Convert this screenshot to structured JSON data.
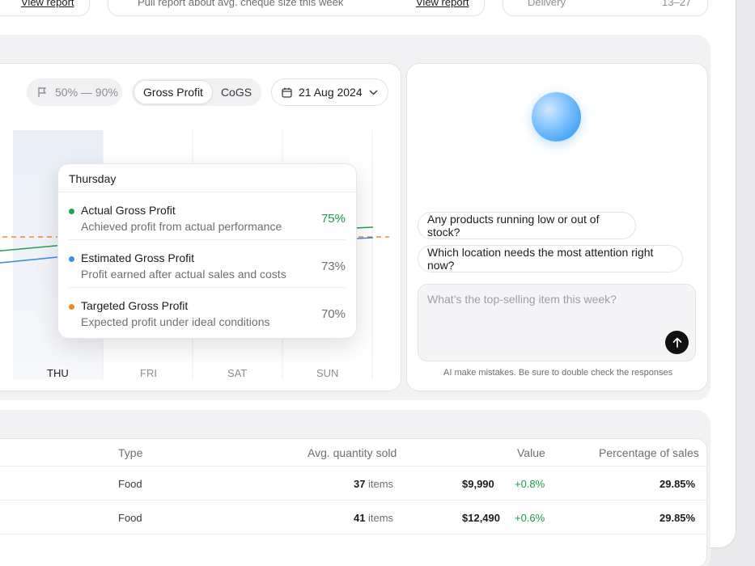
{
  "top_strip": {
    "left_link": "View report",
    "middle_text": "Pull report about avg. cheque size this week",
    "middle_link": "View report",
    "right_label": "Delivery",
    "right_value": "13–27"
  },
  "chart_controls": {
    "threshold_range": "50% — 90%",
    "segments": [
      {
        "label": "Gross Profit",
        "active": true
      },
      {
        "label": "CoGS",
        "active": false
      }
    ],
    "date": "21 Aug 2024"
  },
  "chart_data": {
    "type": "line",
    "categories": [
      "THU",
      "FRI",
      "SAT",
      "SUN"
    ],
    "series": [
      {
        "name": "Actual Gross Profit",
        "color": "#1ea356"
      },
      {
        "name": "Estimated Gross Profit",
        "color": "#3d8fe0"
      },
      {
        "name": "Targeted Gross Profit",
        "color": "#ef8a2c"
      }
    ],
    "highlighted_category": "THU"
  },
  "tooltip": {
    "title": "Thursday",
    "rows": [
      {
        "title": "Actual Gross Profit",
        "subtitle": "Achieved profit from actual performance",
        "value": "75%",
        "color": "#1ea356"
      },
      {
        "title": "Estimated Gross Profit",
        "subtitle": "Profit earned after actual sales and costs",
        "value": "73%",
        "color": "#3d8fe0"
      },
      {
        "title": "Targeted Gross Profit",
        "subtitle": "Expected profit under ideal conditions",
        "value": "70%",
        "color": "#ef8a2c"
      }
    ]
  },
  "assistant": {
    "suggestions": [
      "Any products running low or out of stock?",
      "Which location needs the most attention right now?"
    ],
    "input_placeholder": "What’s the top-selling item this week?",
    "disclaimer": "AI make mistakes. Be sure to double check the responses"
  },
  "table": {
    "headers": [
      "Type",
      "Avg. quantity sold",
      "Value",
      "Percentage of sales"
    ],
    "rows": [
      {
        "type": "Food",
        "qty": "37",
        "qty_unit": "items",
        "value": "$9,990",
        "change": "+0.8%",
        "pct": "29.85%"
      },
      {
        "type": "Food",
        "qty": "41",
        "qty_unit": "items",
        "value": "$12,490",
        "change": "+0.6%",
        "pct": "29.85%"
      }
    ]
  }
}
